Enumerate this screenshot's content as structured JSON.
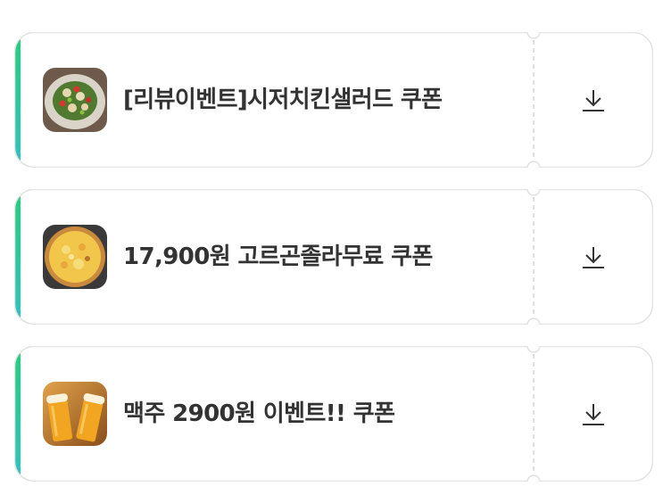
{
  "coupons": [
    {
      "title": "[리뷰이벤트]시저치킨샐러드 쿠폰",
      "image": "caesar-chicken-salad",
      "download_icon": "download-icon"
    },
    {
      "title": "17,900원 고르곤졸라무료 쿠폰",
      "image": "gorgonzola-pizza",
      "download_icon": "download-icon"
    },
    {
      "title": "맥주 2900원 이벤트!! 쿠폰",
      "image": "beer-glasses",
      "download_icon": "download-icon"
    }
  ],
  "colors": {
    "accent_gradient_top": "#22d07a",
    "accent_gradient_bottom": "#2ec4c0",
    "border": "#e3e3e3",
    "text": "#333333"
  }
}
